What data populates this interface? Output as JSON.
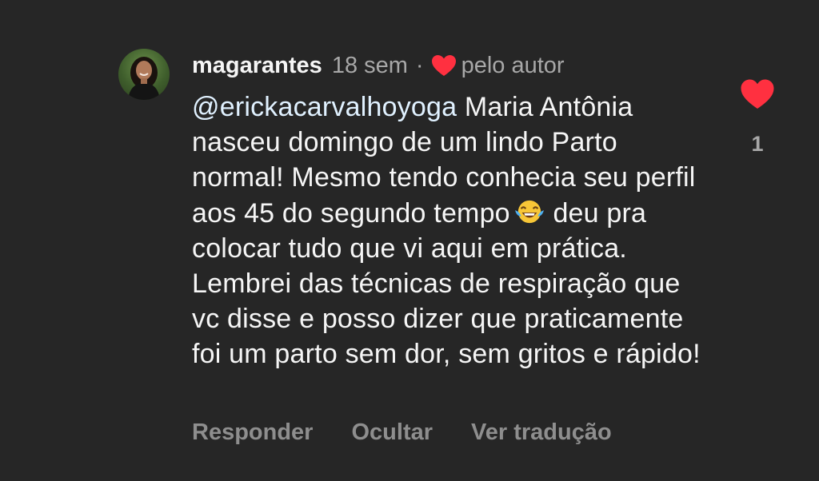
{
  "comment": {
    "username": "magarantes",
    "time": "18 sem",
    "separator": "·",
    "author_like_label": "pelo autor",
    "mention": "@erickacarvalhoyoga",
    "text": " Maria Antônia nasceu domingo de um lindo Parto normal! Mesmo tendo conhecia seu perfil aos 45 do segundo tempo",
    "emoji_name": "face-with-tears-of-joy-icon",
    "text_after_emoji": " deu pra colocar tudo que vi aqui em prática. Lembrei das técnicas de respiração que vc disse e posso dizer que praticamente foi um parto sem dor, sem gritos e rápido!",
    "like_count": "1",
    "heart_color": "#ff3040"
  },
  "actions": {
    "reply": "Responder",
    "hide": "Ocultar",
    "translate": "Ver tradução"
  }
}
